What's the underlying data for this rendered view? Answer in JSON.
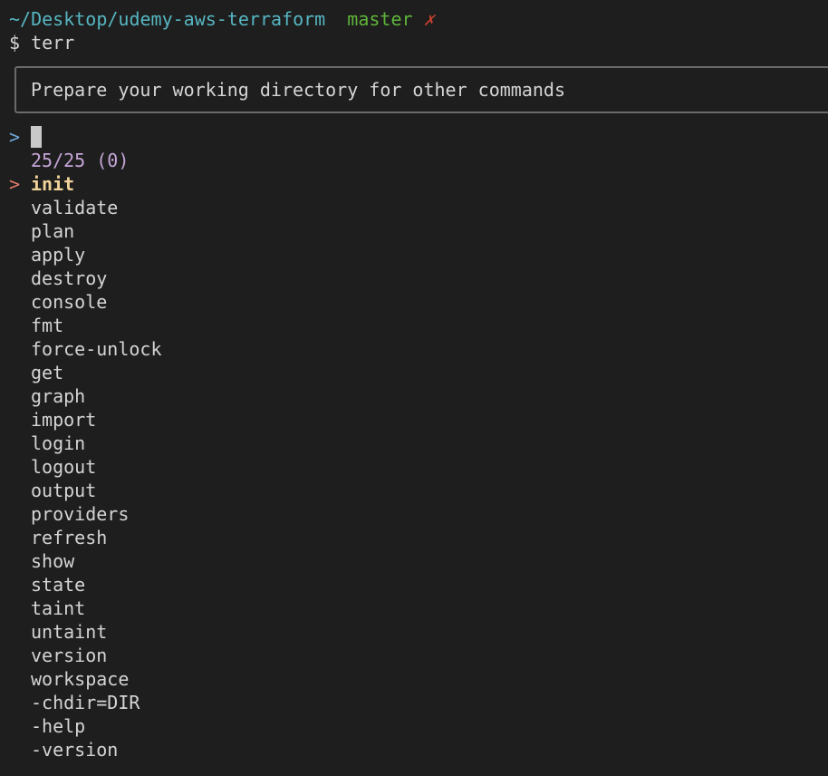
{
  "prompt_header": {
    "path": "~/Desktop/udemy-aws-terraform",
    "branch": "master",
    "dirty_mark": "✗"
  },
  "command_line": {
    "symbol": "$",
    "typed": "terr"
  },
  "preview": {
    "text": "Prepare your working directory for other commands"
  },
  "query": {
    "prompt_symbol": ">",
    "value": ""
  },
  "counter": "25/25 (0)",
  "selected_marker": ">",
  "items": [
    {
      "label": "init",
      "selected": true
    },
    {
      "label": "validate"
    },
    {
      "label": "plan"
    },
    {
      "label": "apply"
    },
    {
      "label": "destroy"
    },
    {
      "label": "console"
    },
    {
      "label": "fmt"
    },
    {
      "label": "force-unlock"
    },
    {
      "label": "get"
    },
    {
      "label": "graph"
    },
    {
      "label": "import"
    },
    {
      "label": "login"
    },
    {
      "label": "logout"
    },
    {
      "label": "output"
    },
    {
      "label": "providers"
    },
    {
      "label": "refresh"
    },
    {
      "label": "show"
    },
    {
      "label": "state"
    },
    {
      "label": "taint"
    },
    {
      "label": "untaint"
    },
    {
      "label": "version"
    },
    {
      "label": "workspace"
    },
    {
      "label": "-chdir=DIR"
    },
    {
      "label": "-help"
    },
    {
      "label": "-version"
    }
  ],
  "colors": {
    "background": "#1e1e1e",
    "path": "#56b6c2",
    "branch": "#5fb43a",
    "dirty": "#c7402f",
    "counter": "#c5a5d7",
    "selected_text": "#f1d29a",
    "selected_marker": "#e07b6a"
  }
}
